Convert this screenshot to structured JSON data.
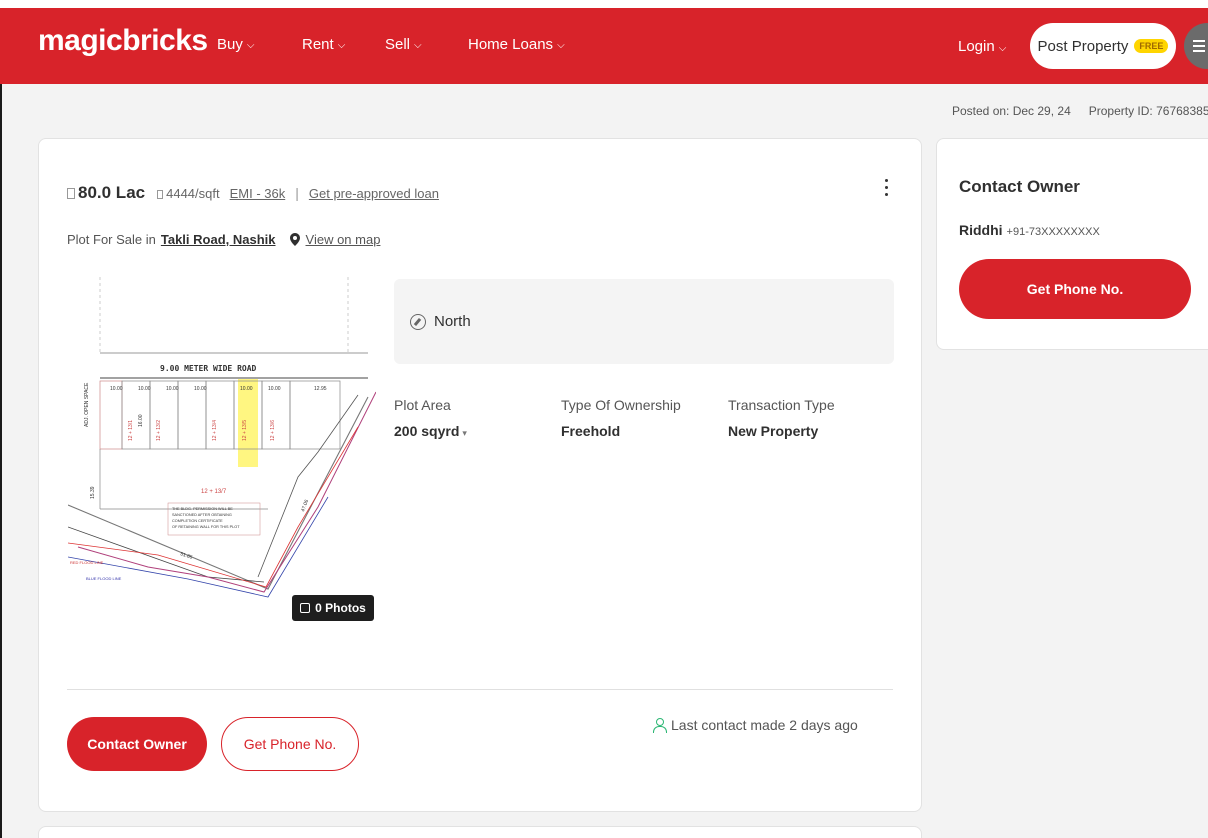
{
  "header": {
    "logo": "magicbricks",
    "nav": [
      {
        "label": "Buy"
      },
      {
        "label": "Rent"
      },
      {
        "label": "Sell"
      },
      {
        "label": "Home Loans"
      }
    ],
    "login": "Login",
    "post_property": "Post Property",
    "free_badge": "FREE",
    "colors": {
      "brand": "#d8232a",
      "badge": "#ffd500"
    }
  },
  "meta": {
    "posted_on": "Posted on: Dec 29, 24",
    "property_id": "Property ID: 76768385"
  },
  "listing": {
    "price": "80.0 Lac",
    "price_per_sqft": "4444/sqft",
    "emi": "EMI - 36k",
    "separator": "|",
    "loan_link": "Get pre-approved loan",
    "subtitle_prefix": "Plot For Sale in",
    "location": "Takli Road, Nashik",
    "map_link": "View on map",
    "photos_badge": "0 Photos",
    "facing": "North",
    "attributes": [
      {
        "label": "Plot Area",
        "value": "200 sqyrd"
      },
      {
        "label": "Type Of Ownership",
        "value": "Freehold"
      },
      {
        "label": "Transaction Type",
        "value": "New Property"
      }
    ],
    "contact_button": "Contact Owner",
    "phone_button": "Get Phone No.",
    "last_contact": "Last contact made 2 days ago"
  },
  "plan_image": {
    "road_label": "9.00 METER WIDE ROAD",
    "open_space": "ADJ. OPEN SPACE",
    "plot_labels": [
      "12 + 13/1",
      "12 + 13/2",
      "12 + 13/4",
      "12 + 13/5",
      "12 + 13/6"
    ],
    "plot_main": "12 + 13/7",
    "dims": [
      "10.00",
      "10.00",
      "10.00",
      "10.00",
      "10.00",
      "10.00",
      "12.95",
      "16.00",
      "15.39",
      "47.06",
      "51.85"
    ],
    "note_lines": [
      "THE BLDG. PERMISSION WILL BE",
      "SANCTIONED AFTER OBTAINING",
      "COMPLETION CERTIFICATE",
      "OF RETAINING WALL FOR THIS PLOT"
    ],
    "red_flood": "RED FLOOD LINE",
    "blue_flood": "BLUE FLOOD LINE"
  },
  "owner": {
    "title": "Contact Owner",
    "name": "Riddhi",
    "phone": "+91-73XXXXXXXX",
    "button": "Get Phone No."
  }
}
